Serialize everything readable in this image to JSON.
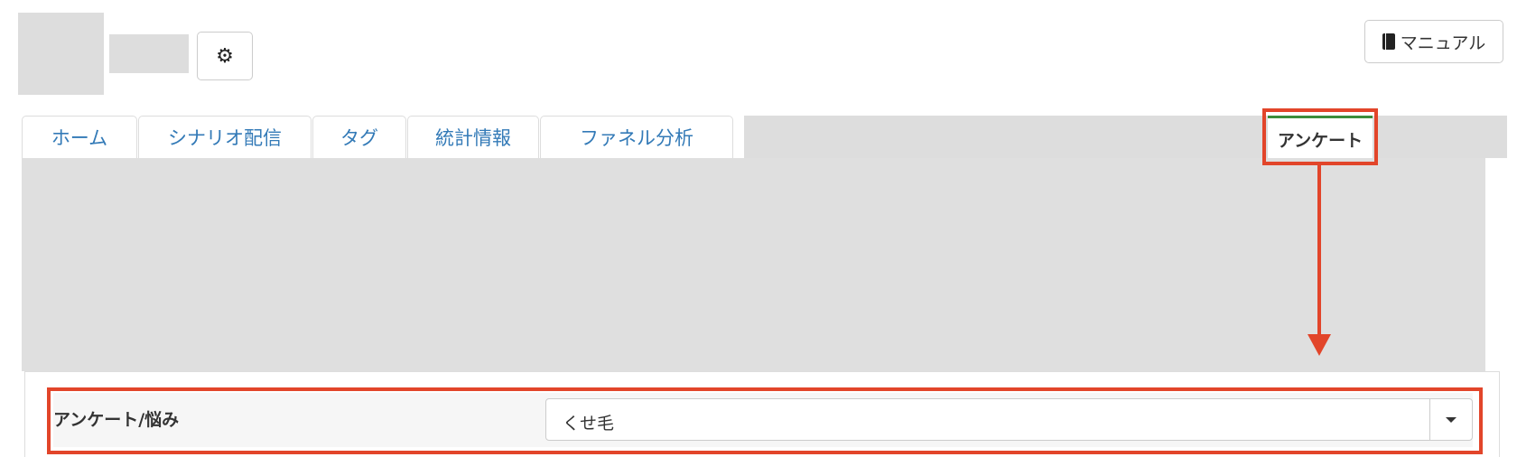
{
  "header": {
    "settings_icon": "gear-icon",
    "manual_label": "マニュアル",
    "manual_icon": "book-icon"
  },
  "tabs": [
    {
      "label": "ホーム"
    },
    {
      "label": "シナリオ配信"
    },
    {
      "label": "タグ"
    },
    {
      "label": "統計情報"
    },
    {
      "label": "ファネル分析"
    }
  ],
  "active_tab": {
    "label": "アンケート"
  },
  "form": {
    "label": "アンケート/悩み",
    "select_value": "くせ毛"
  },
  "colors": {
    "accent": "#e2452a",
    "tab_link": "#337ab7",
    "active_tab_border": "#3c8d3c"
  }
}
